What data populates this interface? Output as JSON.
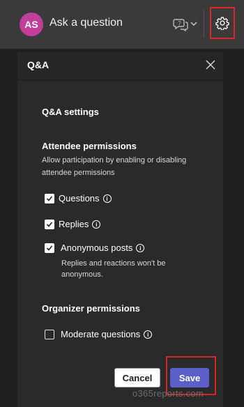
{
  "topbar": {
    "avatar_initials": "AS",
    "ask_label": "Ask a question",
    "qa_icon": "qa-chat-icon",
    "chevron_icon": "chevron-down-icon",
    "settings_icon": "gear-icon"
  },
  "panel": {
    "title": "Q&A",
    "close_icon": "close-icon",
    "settings_title": "Q&A settings",
    "attendee": {
      "title": "Attendee permissions",
      "description": "Allow participation by enabling or disabling attendee permissions",
      "options": [
        {
          "label": "Questions",
          "checked": true
        },
        {
          "label": "Replies",
          "checked": true
        },
        {
          "label": "Anonymous posts",
          "checked": true,
          "sub": "Replies and reactions won't be anonymous."
        }
      ]
    },
    "organizer": {
      "title": "Organizer permissions",
      "options": [
        {
          "label": "Moderate questions",
          "checked": false
        }
      ]
    },
    "buttons": {
      "cancel": "Cancel",
      "save": "Save"
    }
  },
  "watermark": "o365reports.com",
  "colors": {
    "accent": "#5b5fc7",
    "highlight": "#e0262b",
    "avatar": "#c13e9a"
  }
}
